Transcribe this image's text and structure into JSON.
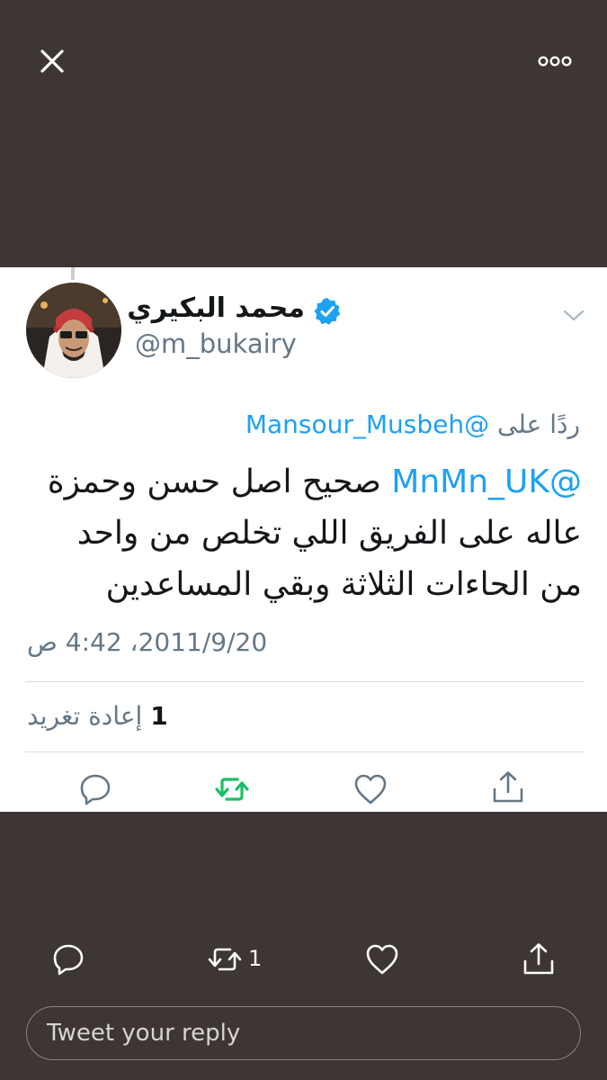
{
  "topbar": {
    "close_icon": "close-icon",
    "more_icon": "more-horizontal-icon"
  },
  "tweet": {
    "display_name": "محمد البكيري",
    "handle": "@m_bukairy",
    "verified": true,
    "reply_to_prefix": "ردًا على",
    "reply_to_user": "@Mansour_Musbeh",
    "mention": "@MnMn_UK",
    "text_rest": "صحيح اصل حسن وحمزة عاله على الفريق اللي تخلص من واحد من الحاءات الثلاثة وبقي المساعدين",
    "timestamp": "2011/9/20، 4:42 ص",
    "retweet_count": "1",
    "retweet_label": "إعادة تغريد"
  },
  "actions": {
    "icons": [
      "reply-icon",
      "retweet-icon",
      "like-icon",
      "share-icon"
    ],
    "bottom_retweet_count": "1"
  },
  "reply": {
    "placeholder": "Tweet your reply"
  },
  "colors": {
    "backdrop": "#3d3634",
    "link": "#1da1f2",
    "retweet_active": "#17bf63",
    "secondary_text": "#657786"
  }
}
